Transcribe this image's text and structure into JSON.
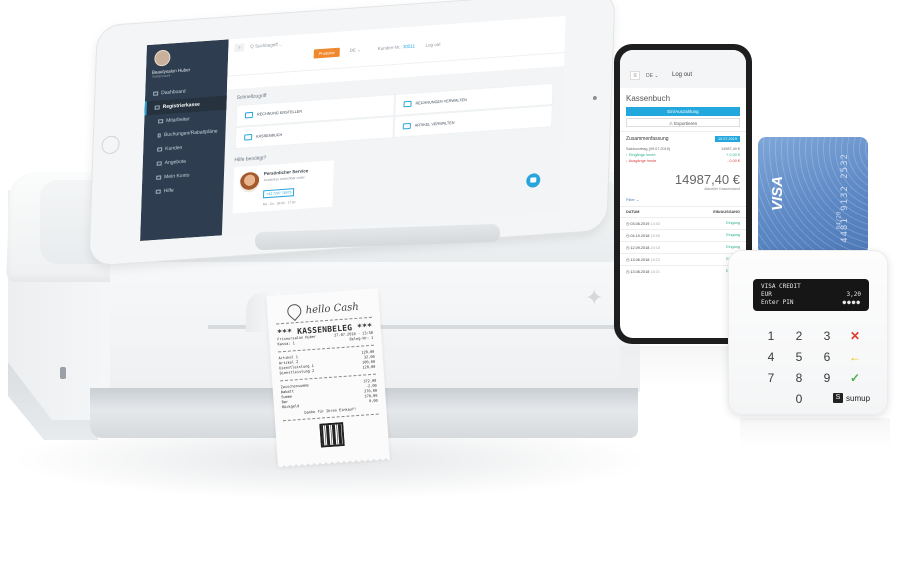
{
  "tablet_app": {
    "user": {
      "name": "Beautysalon Huber",
      "subtitle": "Testaccount"
    },
    "sidebar": [
      {
        "label": "Dashboard",
        "active": false
      },
      {
        "label": "Registrierkasse",
        "active": true
      },
      {
        "label": "Mitarbeiter",
        "active": false
      },
      {
        "label": "Buchungen/Rabattpläne",
        "active": false
      },
      {
        "label": "Kunden",
        "active": false
      },
      {
        "label": "Angebote",
        "active": false
      },
      {
        "label": "Mein Konto",
        "active": false
      },
      {
        "label": "Hilfe",
        "active": false
      }
    ],
    "topbar": {
      "menu_icon": "≡",
      "search_placeholder": "Q Suchbegriff ...",
      "produkte_label": "Produkte",
      "lang": "DE ⌄",
      "kunden_label": "Kunden-Nr.:",
      "kunden_no": "30511",
      "logout": "Log out"
    },
    "quick_access": {
      "heading": "Schnellzugriff",
      "items": [
        "RECHNUNG ERSTELLEN",
        "RECHNUNGEN VERWALTEN",
        "KASSENBUCH",
        "ARTIKEL VERWALTEN"
      ]
    },
    "help": {
      "heading": "Hilfe benötigt?",
      "title": "Persönlicher Service",
      "subtitle": "Kostenlos erreichbar unter:",
      "phone": "+43 7207 76975",
      "hours_days": "Mo - Do",
      "hours_time": "08:00 - 17:00"
    }
  },
  "receipt": {
    "brand": "hello Cash",
    "title": "*** KASSENBELEG ***",
    "header_lines": [
      [
        "Friseursalon Huber",
        "27.07.2018 - 13:58"
      ],
      [
        "Kassa: 1",
        "Beleg-Nr: 1"
      ]
    ],
    "items": [
      [
        "Artikel 1",
        "120,00"
      ],
      [
        "Artikel 2",
        "32,00"
      ],
      [
        "Dienstleistung 1",
        "100,00"
      ],
      [
        "Dienstleistung 2",
        "120,00"
      ]
    ],
    "totals": [
      [
        "Zwischensumme",
        "372,00"
      ],
      [
        "Rabatt",
        "-2,00"
      ],
      [
        "Summe",
        "370,00"
      ],
      [
        "Bar",
        "370,00"
      ],
      [
        "Rückgeld",
        "0,00"
      ]
    ],
    "thanks": "Danke für Ihren Einkauf!"
  },
  "phone_app": {
    "menu_icon": "≡",
    "lang": "DE ⌄",
    "logout": "Log out",
    "title": "Kassenbuch",
    "primary_button": "Ein/Auszahlung",
    "export_button": "⚠ Exportieren",
    "summary": {
      "heading": "Zusammenfassung",
      "date": "10.07.2019",
      "rows": [
        {
          "label": "Saldovortrag (09.07.2019)",
          "value": "14987,40 €",
          "kind": "neutral"
        },
        {
          "label": "↑ Eingänge heute",
          "value": "+ 0,00 €",
          "kind": "green"
        },
        {
          "label": "↓ Ausgänge heute",
          "value": "- 0,00 €",
          "kind": "red"
        }
      ],
      "balance": "14987,40 €",
      "balance_label": "Aktueller Kassenstand"
    },
    "filter": "Filter ⌄",
    "table": {
      "headers": [
        "DATUM",
        "EIN/AUSGANG"
      ],
      "rows": [
        {
          "date": "03.06.2019",
          "time": "13:53",
          "type": "Eingang"
        },
        {
          "date": "04.10.2018",
          "time": "15:05",
          "type": "Eingang"
        },
        {
          "date": "12.09.2018",
          "time": "20:18",
          "type": "Eingang"
        },
        {
          "date": "13.06.2018",
          "time": "18:23",
          "type": "Eingang"
        },
        {
          "date": "13.06.2018",
          "time": "18:21",
          "type": "Eingang"
        }
      ]
    }
  },
  "credit_card": {
    "brand": "VISA",
    "number": "4481 9132 2532",
    "expiry": "04/20"
  },
  "card_reader": {
    "display": {
      "line1": "VISA CREDIT",
      "currency": "EUR",
      "amount": "3,20",
      "line3": "Enter PIN",
      "pin_mask": "●●●●"
    },
    "keys": [
      "1",
      "2",
      "3",
      "✕",
      "4",
      "5",
      "6",
      "←",
      "7",
      "8",
      "9",
      "✓",
      "",
      "0",
      "",
      ""
    ],
    "brand": "sumup",
    "brand_icon": "S"
  },
  "colors": {
    "accent_blue": "#22a8dc",
    "orange": "#f0882c",
    "sidebar": "#2e3d4f",
    "cancel": "#e03c31",
    "back": "#f2c200",
    "ok": "#4caf50"
  }
}
